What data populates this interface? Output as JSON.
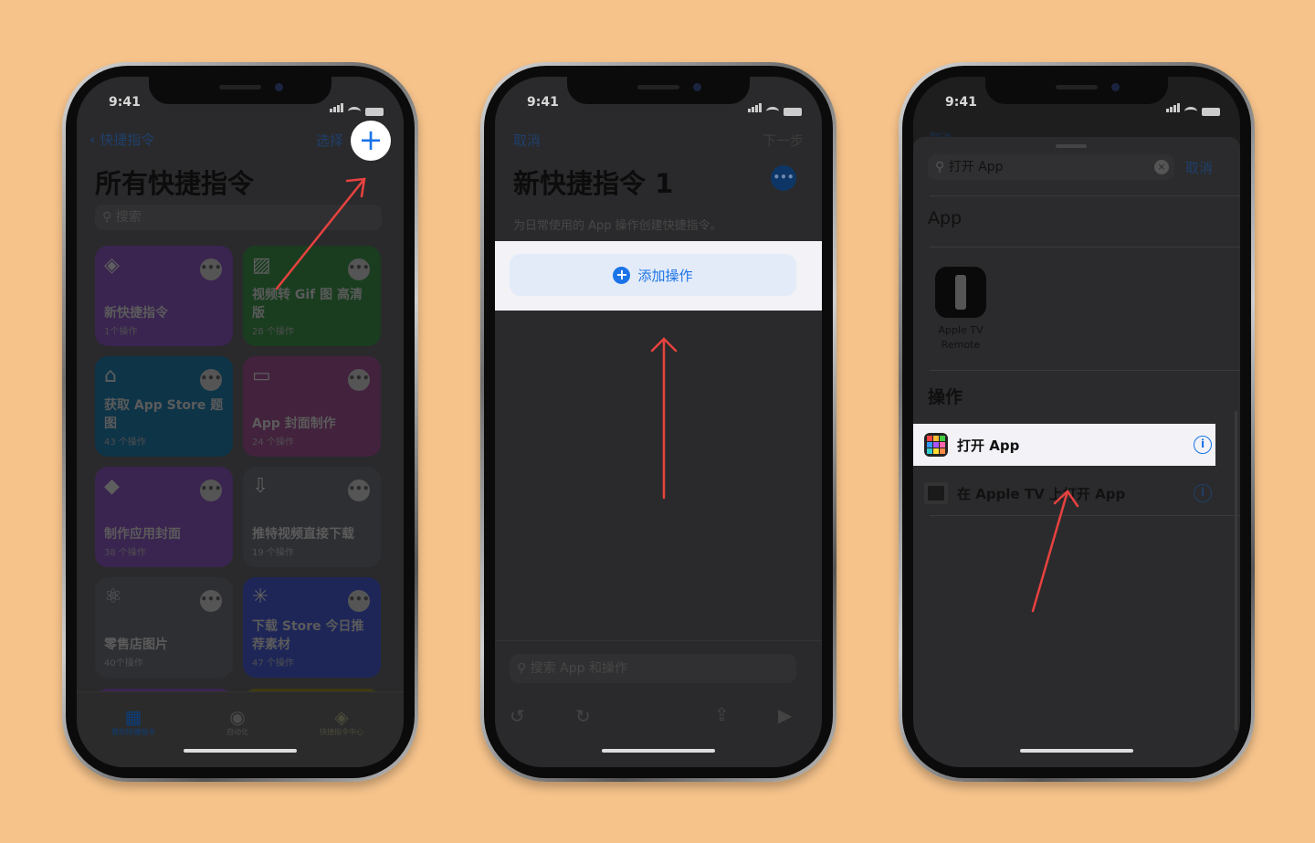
{
  "colors": {
    "background": "#f6c38b",
    "accent_blue": "#1a73e8",
    "arrow_red": "#e8423f",
    "highlight": "#f2f2f7"
  },
  "phone1": {
    "status_time": "9:41",
    "nav": {
      "back_label": "快捷指令",
      "select_label": "选择",
      "add_icon": "plus-icon"
    },
    "title": "所有快捷指令",
    "search_placeholder": "搜索",
    "cards": [
      {
        "name": "新快捷指令",
        "count": "1个操作",
        "icon": "layers-icon",
        "color": "#3a2450"
      },
      {
        "name": "视频转 Gif 图 高清版",
        "count": "28 个操作",
        "icon": "image-icon",
        "color": "#1a3d20"
      },
      {
        "name": "获取 App Store 题图",
        "count": "43 个操作",
        "icon": "gift-icon",
        "color": "#0e3448"
      },
      {
        "name": "App 封面制作",
        "count": "24 个操作",
        "icon": "card-icon",
        "color": "#43223d"
      },
      {
        "name": "制作应用封面",
        "count": "38 个操作",
        "icon": "tag-icon",
        "color": "#3a2450"
      },
      {
        "name": "推特视频直接下载",
        "count": "19 个操作",
        "icon": "download-icon",
        "color": "#2e2f33"
      },
      {
        "name": "零售店图片",
        "count": "40个操作",
        "icon": "atom-icon",
        "color": "#2e2f33"
      },
      {
        "name": "下载 Store 今日推荐素材",
        "count": "47 个操作",
        "icon": "magic-wand-icon",
        "color": "#1e2658"
      }
    ],
    "tabs": [
      {
        "label": "我的快捷指令",
        "icon": "grid-icon"
      },
      {
        "label": "自动化",
        "icon": "clock-check-icon"
      },
      {
        "label": "快捷指令中心",
        "icon": "layers-icon"
      }
    ]
  },
  "phone2": {
    "status_time": "9:41",
    "nav": {
      "cancel_label": "取消",
      "next_label": "下一步"
    },
    "title": "新快捷指令 1",
    "subtitle": "为日常使用的 App 操作创建快捷指令。",
    "add_action_label": "添加操作",
    "search_placeholder": "搜索 App 和操作",
    "toolbar_icons": [
      "undo-icon",
      "redo-icon",
      "share-icon",
      "play-icon"
    ]
  },
  "phone3": {
    "status_time": "9:41",
    "behind_cancel": "取消",
    "search_value": "打开 App",
    "cancel_label": "取消",
    "section_app": "App",
    "app_item": {
      "name": "Apple TV Remote"
    },
    "section_actions": "操作",
    "actions": [
      {
        "label": "打开 App",
        "icon": "app-grid-icon",
        "highlighted": true
      },
      {
        "label": "在 Apple TV 上打开 App",
        "icon": "film-icon",
        "highlighted": false
      }
    ]
  }
}
